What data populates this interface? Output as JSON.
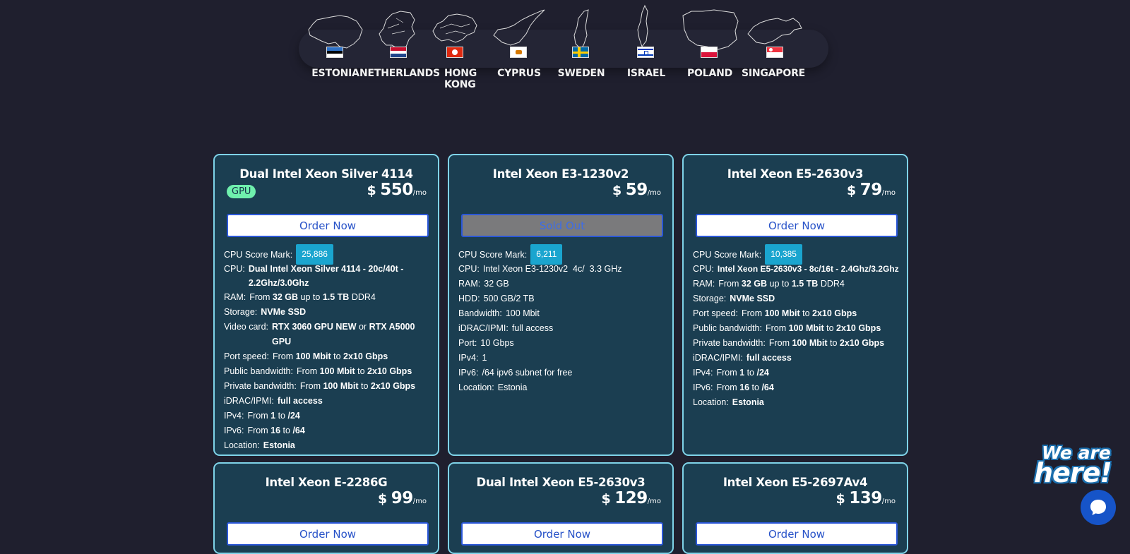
{
  "locations": [
    {
      "name": "ESTONIA",
      "flag": "estonia-flag"
    },
    {
      "name": "NETHERLANDS",
      "flag": "netherlands-flag"
    },
    {
      "name": "HONG KONG",
      "flag": "hong-kong-flag"
    },
    {
      "name": "CYPRUS",
      "flag": "cyprus-flag"
    },
    {
      "name": "SWEDEN",
      "flag": "sweden-flag"
    },
    {
      "name": "ISRAEL",
      "flag": "israel-flag"
    },
    {
      "name": "POLAND",
      "flag": "poland-flag"
    },
    {
      "name": "SINGAPORE",
      "flag": "singapore-flag"
    }
  ],
  "currency": "$",
  "per": "/mo",
  "order_label": "Order Now",
  "sold_out_label": "Sold Out",
  "gpu_badge": "GPU",
  "cards": [
    {
      "title": "Dual Intel Xeon Silver 4114",
      "price": "550",
      "score_label": "CPU Score Mark:",
      "score": "25,886",
      "specs": [
        {
          "label": "CPU:",
          "value": "Dual Intel Xeon Silver 4114 - 20c/40t - 2.2Ghz/3.0Ghz"
        },
        {
          "label": "RAM:",
          "value": "From 32 GB up to 1.5 TB DDR4"
        },
        {
          "label": "Storage:",
          "value": "NVMe SSD"
        },
        {
          "label": "Video card:",
          "value": "RTX 3060 GPU NEW or RTX A5000 GPU"
        },
        {
          "label": "Port speed:",
          "value": "From 100 Mbit to 2x10 Gbps"
        },
        {
          "label": "Public bandwidth:",
          "value": "From 100 Mbit to 2x10 Gbps"
        },
        {
          "label": "Private bandwidth:",
          "value": "From 100 Mbit to 2x10 Gbps"
        },
        {
          "label": "iDRAC/IPMI:",
          "value": "full access"
        },
        {
          "label": "IPv4:",
          "value": "From 1 to /24"
        },
        {
          "label": "IPv6:",
          "value": "From 16 to /64"
        },
        {
          "label": "Location:",
          "value": "Estonia"
        }
      ]
    },
    {
      "title": "Intel Xeon E3-1230v2",
      "price": "59",
      "score_label": "CPU Score Mark:",
      "score": "6,211",
      "specs": [
        {
          "label": "CPU:",
          "value": "Intel Xeon E3-1230v2  4c/  3.3 GHz"
        },
        {
          "label": "RAM:",
          "value": "32 GB"
        },
        {
          "label": "HDD:",
          "value": "500 GB/2 TB"
        },
        {
          "label": "Bandwidth:",
          "value": "100 Mbit"
        },
        {
          "label": "iDRAC/IPMI:",
          "value": "full access"
        },
        {
          "label": "Port:",
          "value": "10 Gbps"
        },
        {
          "label": "IPv4:",
          "value": "1"
        },
        {
          "label": "IPv6:",
          "value": "/64 ipv6 subnet for free"
        },
        {
          "label": "Location:",
          "value": "Estonia"
        }
      ]
    },
    {
      "title": "Intel Xeon E5-2630v3",
      "price": "79",
      "score_label": "CPU Score Mark:",
      "score": "10,385",
      "specs": [
        {
          "label": "CPU:",
          "value": "Intel Xeon E5-2630v3 - 8c/16t - 2.4Ghz/3.2Ghz"
        },
        {
          "label": "RAM:",
          "value": "From 32 GB up to 1.5 TB DDR4"
        },
        {
          "label": "Storage:",
          "value": "NVMe SSD"
        },
        {
          "label": "Port speed:",
          "value": "From 100 Mbit to 2x10 Gbps"
        },
        {
          "label": "Public bandwidth:",
          "value": "From 100 Mbit to 2x10 Gbps"
        },
        {
          "label": "Private bandwidth:",
          "value": "From 100 Mbit to 2x10 Gbps"
        },
        {
          "label": "iDRAC/IPMI:",
          "value": "full access"
        },
        {
          "label": "IPv4:",
          "value": "From 1 to /24"
        },
        {
          "label": "IPv6:",
          "value": "From 16 to /64"
        },
        {
          "label": "Location:",
          "value": "Estonia"
        }
      ]
    },
    {
      "title": "Intel Xeon E-2286G",
      "price": "99"
    },
    {
      "title": "Dual Intel Xeon E5-2630v3",
      "price": "129"
    },
    {
      "title": "Intel Xeon E5-2697Av4",
      "price": "139"
    }
  ],
  "chat": {
    "line1": "We are",
    "line2": "here!"
  },
  "colors": {
    "card_bg": "#1b3e51",
    "card_border": "#7fd3e8",
    "page_bg": "#1f1f2e",
    "score_badge": "#1aa5cf",
    "gpu_badge": "#6ff0ad",
    "button_border": "#2b57d8"
  }
}
